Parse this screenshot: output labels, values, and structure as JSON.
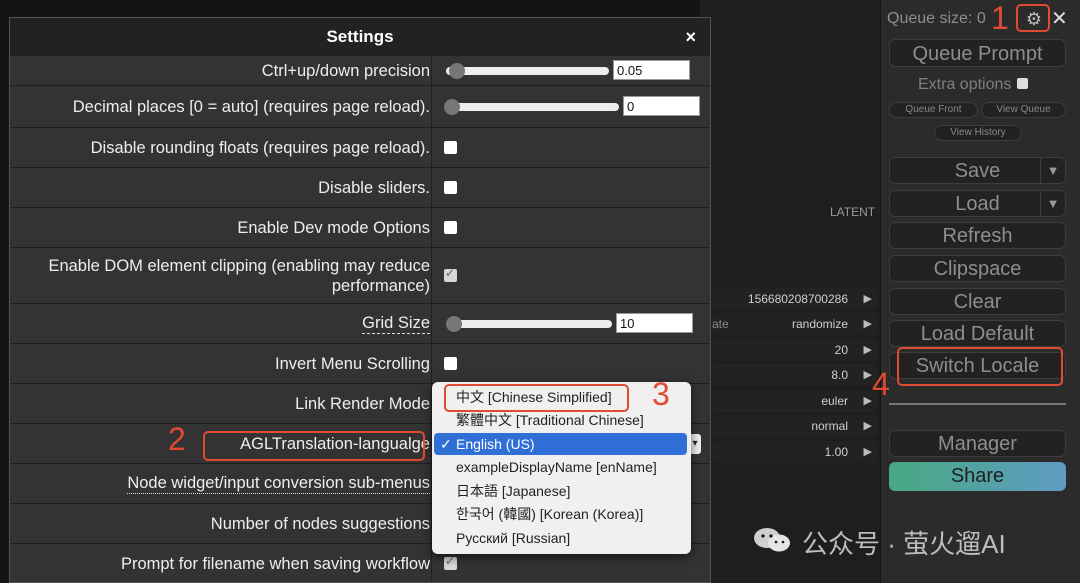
{
  "menu": {
    "queue_size": "Queue size: 0",
    "queue_prompt": "Queue Prompt",
    "extra_options": "Extra options",
    "queue_front": "Queue Front",
    "view_queue": "View Queue",
    "view_history": "View History",
    "save": "Save",
    "load": "Load",
    "dropdown_arrow": "▼",
    "refresh": "Refresh",
    "clipspace": "Clipspace",
    "clear": "Clear",
    "load_default": "Load Default",
    "switch_locale": "Switch Locale",
    "manager": "Manager",
    "share": "Share",
    "close": "✕"
  },
  "canvas": {
    "latent_label": "LATENT",
    "widgets": [
      {
        "key": "",
        "value": "156680208700286"
      },
      {
        "key": "ate",
        "value": "randomize"
      },
      {
        "key": "",
        "value": "20"
      },
      {
        "key": "",
        "value": "8.0"
      },
      {
        "key": "",
        "value": "euler"
      },
      {
        "key": "",
        "value": "normal"
      },
      {
        "key": "",
        "value": "1.00"
      }
    ],
    "arrow": "▶"
  },
  "settings": {
    "title": "Settings",
    "close": "×",
    "rows": [
      {
        "label": "Ctrl+up/down precision",
        "control": "slider",
        "value": "0.05",
        "level": 0.05
      },
      {
        "label": "Decimal places [0 = auto] (requires page reload).",
        "control": "slider",
        "value": "0",
        "level": 0.0
      },
      {
        "label": "Disable rounding floats (requires page reload).",
        "control": "checkbox",
        "checked": false
      },
      {
        "label": "Disable sliders.",
        "control": "checkbox",
        "checked": false
      },
      {
        "label": "Enable Dev mode Options",
        "control": "checkbox",
        "checked": false
      },
      {
        "label": "Enable DOM element clipping (enabling may reduce performance)",
        "control": "checkbox",
        "checked": true
      },
      {
        "label": "Grid Size",
        "control": "slider",
        "value": "10",
        "level": 0.02
      },
      {
        "label": "Invert Menu Scrolling",
        "control": "checkbox",
        "checked": false
      },
      {
        "label": "Link Render Mode",
        "control": "select"
      },
      {
        "label": "AGLTranslation-langualge",
        "control": "select"
      },
      {
        "label": "Node widget/input conversion sub-menus",
        "control": "checkbox",
        "checked": false
      },
      {
        "label": "Number of nodes suggestions",
        "control": "slider",
        "value": "",
        "level": 0.0
      },
      {
        "label": "Prompt for filename when saving workflow",
        "control": "checkbox",
        "checked": true
      }
    ]
  },
  "language_options": [
    {
      "label": "中文 [Chinese Simplified]",
      "selected": false
    },
    {
      "label": "繁體中文 [Traditional Chinese]",
      "selected": false
    },
    {
      "label": "English (US)",
      "selected": true
    },
    {
      "label": "exampleDisplayName [enName]",
      "selected": false
    },
    {
      "label": "日本語 [Japanese]",
      "selected": false
    },
    {
      "label": "한국어 (韓國) [Korean (Korea)]",
      "selected": false
    },
    {
      "label": "Русский [Russian]",
      "selected": false
    }
  ],
  "annotations": {
    "n1": "1",
    "n2": "2",
    "n3": "3",
    "n4": "4"
  },
  "watermark": "公众号 · 萤火遛AI",
  "icons": {
    "gear": "gear-icon",
    "check": "✓"
  }
}
